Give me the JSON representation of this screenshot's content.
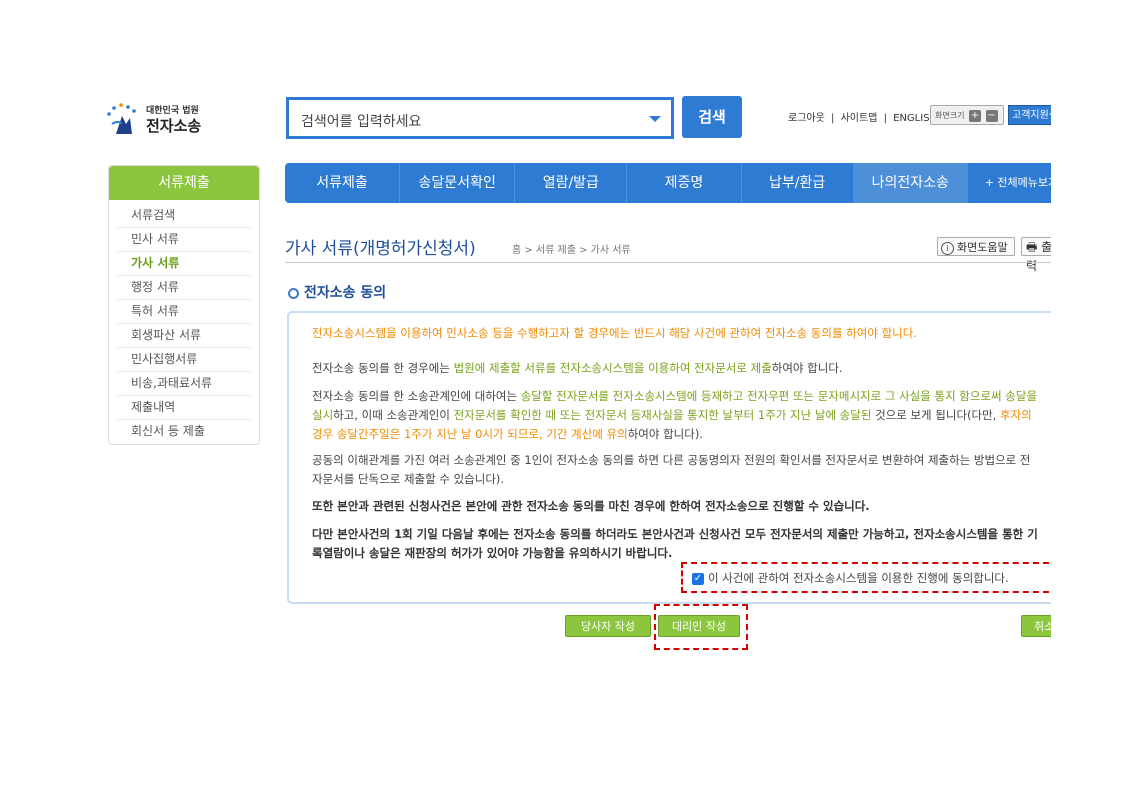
{
  "header": {
    "logo_small": "대한민국 법원",
    "logo_big": "전자소송",
    "search_placeholder": "검색어를 입력하세요",
    "search_button": "검색",
    "util_links": [
      "로그아웃",
      "|",
      "사이트맵",
      "|",
      "ENGLISH"
    ],
    "font_size_label": "화면크기",
    "font_plus": "+",
    "font_minus": "−",
    "support_label": "고객지원센터"
  },
  "leftmenu": {
    "title": "서류제출",
    "items": [
      "서류검색",
      "민사 서류",
      "가사 서류",
      "행정 서류",
      "특허 서류",
      "회생파산 서류",
      "민사집행서류",
      "비송,과태료서류",
      "제출내역",
      "회신서 등 제출"
    ],
    "active_index": 2
  },
  "nav": {
    "items": [
      "서류제출",
      "송달문서확인",
      "열람/발급",
      "제증명",
      "납부/환급",
      "나의전자소송",
      "+ 전체메뉴보기"
    ]
  },
  "page": {
    "title": "가사 서류(개명허가신청서)",
    "breadcrumb": "홈 > 서류 제출 > 가사 서류",
    "help_button": "화면도움말",
    "print_button": "출력"
  },
  "section": {
    "title": "전자소송 동의"
  },
  "content": {
    "p1": "전자소송시스템을 이용하여 민사소송 등을 수행하고자 할 경우에는 반드시 해당 사건에 관하여 전자소송 동의를 하여야 합니다.",
    "p2_a": "전자소송 동의를 한 경우에는 ",
    "p2_b": "법원에 제출할 서류를 전자소송시스템을 이용하여 전자문서로 제출",
    "p2_c": "하여야 합니다.",
    "p3_a": "전자소송 동의를 한 소송관계인에 대하여는 ",
    "p3_b": "송달할 전자문서를 전자소송시스템에 등재하고 전자우편 또는 문자메시지로 그 사실을 통지",
    "p3_c": " 함으로써 송달을 실시",
    "p3_d": "하고, 이때 소송관계인이 ",
    "p3_e": "전자문서를 확인한 때 또는 전자문서 등재사실을 통지한 날부터 1주가 지난 날에 송달된",
    "p3_f": " 것으로 보게 됩니다(다만, ",
    "p3_g": "후자의 경우 송달간주일은 1주가 지난 날 0시가 되므로, 기간 계산에 유의",
    "p3_h": "하여야 합니다).",
    "p4": "공동의 이해관계를 가진 여러 소송관계인 중 1인이 전자소송 동의를 하면 다른 공동명의자 전원의 확인서를 전자문서로 변환하여 제출하는 방법으로 전자문서를 단독으로 제출할 수 있습니다).",
    "p5": "또한 본안과 관련된 신청사건은 본안에 관한 전자소송 동의를 마친 경우에 한하여 전자소송으로 진행할 수 있습니다.",
    "p6": "다만 본안사건의 1회 기일 다음날 후에는 전자소송 동의를 하더라도 본안사건과 신청사건 모두 전자문서의 제출만 가능하고, 전자소송시스템을 통한 기록열람이나 송달은 재판장의 허가가 있어야 가능함을 유의하시기 바랍니다.",
    "agree_label": "이 사건에 관하여 전자소송시스템을 이용한 진행에 동의합니다.",
    "agree_checked": true
  },
  "buttons": {
    "party": "당사자 작성",
    "agent": "대리인 작성",
    "cancel": "취소"
  }
}
